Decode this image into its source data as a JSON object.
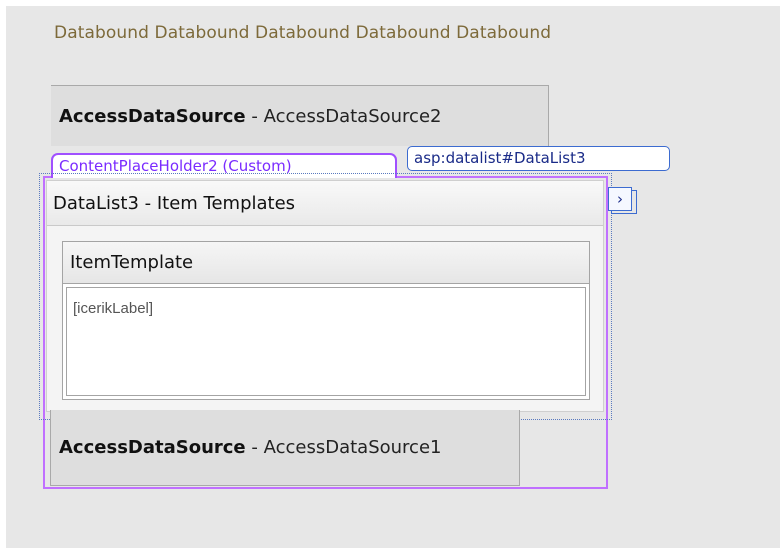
{
  "databound_row": "Databound Databound Databound Databound Databound",
  "access_ds_top": {
    "label_bold": "AccessDataSource",
    "separator": " - ",
    "name": "AccessDataSource2"
  },
  "content_placeholder": {
    "label": "ContentPlaceHolder2 (Custom)"
  },
  "asp_tag": {
    "label": "asp:datalist#DataList3"
  },
  "smart_tag": {
    "glyph": "›"
  },
  "datalist": {
    "title": "DataList3 - Item Templates",
    "template_header": "ItemTemplate",
    "label_field": "[icerikLabel]"
  },
  "access_ds_bottom": {
    "label_bold": "AccessDataSource",
    "separator": " - ",
    "name": "AccessDataSource1"
  },
  "colors": {
    "canvas": "#e7e7e7",
    "databound_text": "#7d6a3a",
    "placeholder_border": "#a050ff",
    "tag_border": "#3c6bd0"
  }
}
